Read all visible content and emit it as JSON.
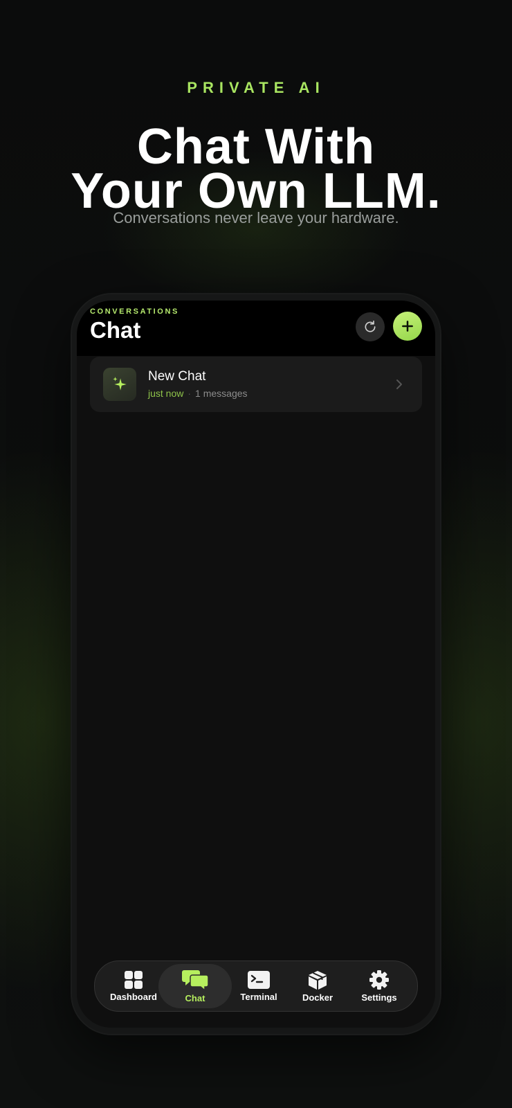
{
  "hero": {
    "eyebrow": "PRIVATE AI",
    "headline_line1": "Chat With",
    "headline_line2": "Your Own LLM.",
    "subtitle": "Conversations never leave your hardware."
  },
  "header": {
    "section_label": "CONVERSATIONS",
    "title": "Chat",
    "refresh_icon": "refresh-icon",
    "add_icon": "plus-icon"
  },
  "conversations": [
    {
      "title": "New Chat",
      "time": "just now",
      "separator": "·",
      "count": "1 messages",
      "icon": "sparkle-icon"
    }
  ],
  "tabs": [
    {
      "label": "Dashboard",
      "icon": "grid-icon",
      "active": false
    },
    {
      "label": "Chat",
      "icon": "chat-bubbles-icon",
      "active": true
    },
    {
      "label": "Terminal",
      "icon": "terminal-icon",
      "active": false
    },
    {
      "label": "Docker",
      "icon": "box-icon",
      "active": false
    },
    {
      "label": "Settings",
      "icon": "gear-icon",
      "active": false
    }
  ],
  "colors": {
    "accent": "#a9e561",
    "background": "#0d0f0e",
    "screen": "#0f0f0f"
  }
}
